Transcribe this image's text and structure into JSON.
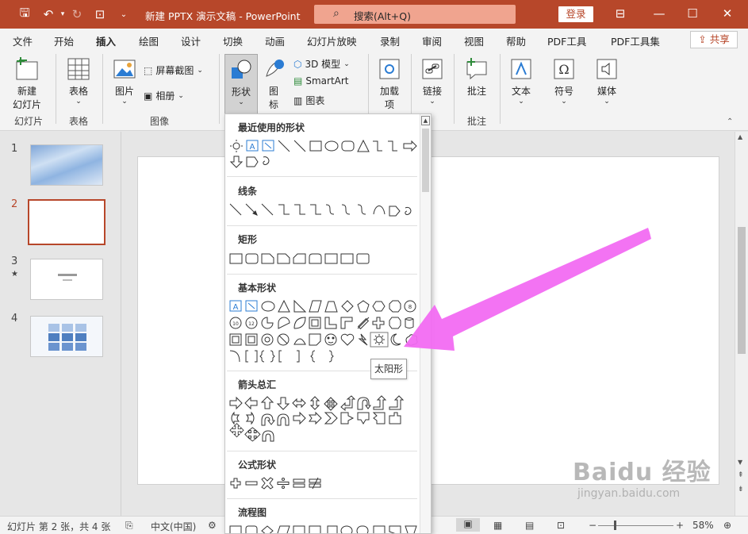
{
  "titlebar": {
    "doc_title": "新建 PPTX 演示文稿  -  PowerPoint",
    "search_text": "搜索(Alt+Q)",
    "login_label": "登录"
  },
  "tabs": [
    "文件",
    "开始",
    "插入",
    "绘图",
    "设计",
    "切换",
    "动画",
    "幻灯片放映",
    "录制",
    "审阅",
    "视图",
    "帮助",
    "PDF工具",
    "PDF工具集"
  ],
  "active_tab": "插入",
  "share_label": "共享",
  "ribbon": {
    "new_slide": [
      "新建",
      "幻灯片"
    ],
    "table": "表格",
    "picture": "图片",
    "screenshot": "屏幕截图",
    "album": "相册",
    "shapes": "形状",
    "icons": [
      "图",
      "标"
    ],
    "model3d": "3D 模型",
    "smartart": "SmartArt",
    "chart": "图表",
    "addins": [
      "加载",
      "项"
    ],
    "link": "链接",
    "comment": "批注",
    "text": "文本",
    "symbol": "符号",
    "media": "媒体",
    "group_labels": {
      "slides": "幻灯片",
      "tables": "表格",
      "images": "图像",
      "comments": "批注"
    }
  },
  "thumbnails": [
    {
      "num": "1",
      "mark": ""
    },
    {
      "num": "2",
      "mark": ""
    },
    {
      "num": "3",
      "mark": "★"
    },
    {
      "num": "4",
      "mark": ""
    }
  ],
  "shapes_panel": {
    "categories": [
      "最近使用的形状",
      "线条",
      "矩形",
      "基本形状",
      "箭头总汇",
      "公式形状",
      "流程图"
    ],
    "tooltip": "太阳形"
  },
  "statusbar": {
    "slide_info": "幻灯片 第 2 张，共 4 张",
    "language": "中文(中国)",
    "zoom": "58%"
  },
  "watermark": {
    "line1": "Baidu 经验",
    "line2": "jingyan.baidu.com"
  },
  "colors": {
    "accent": "#b7472a",
    "arrow": "#f26bf2"
  }
}
